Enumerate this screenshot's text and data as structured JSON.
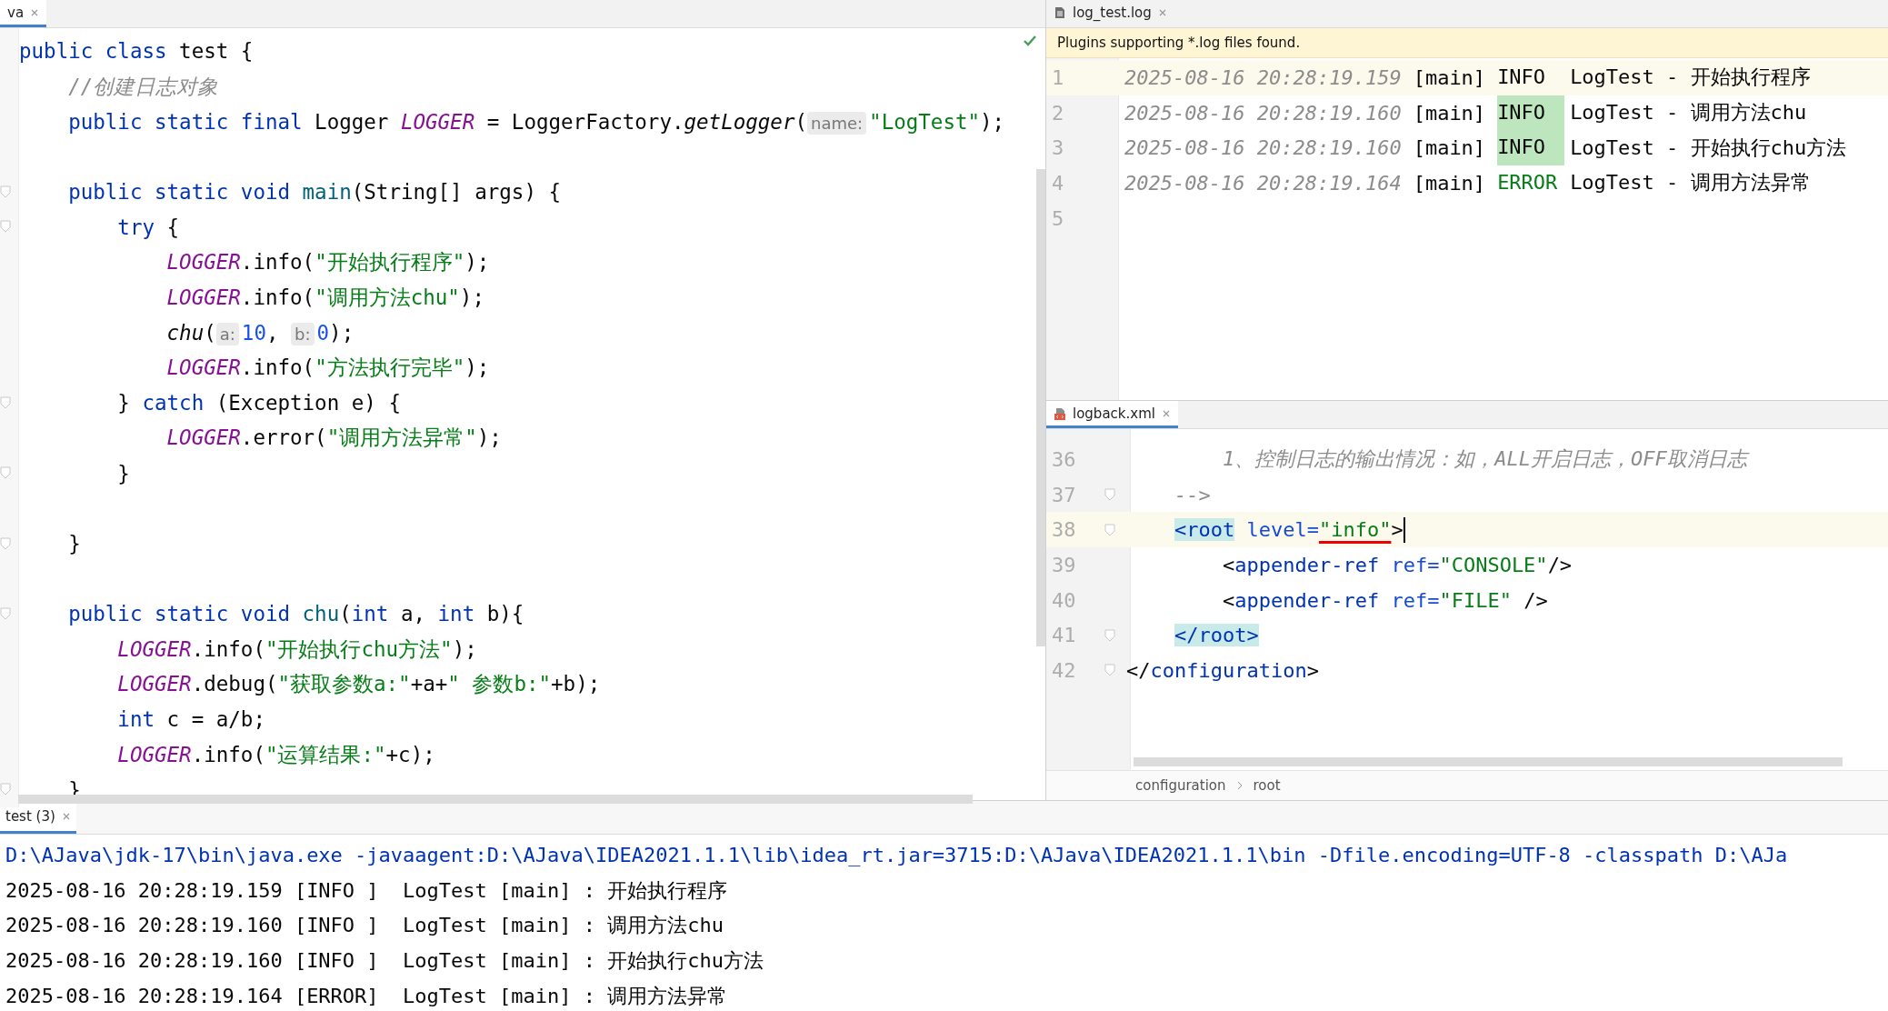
{
  "editor": {
    "tab": {
      "label": "va",
      "selected": true
    },
    "lines": [
      {
        "fold": false,
        "tokens": [
          {
            "kind": "kw",
            "text": "public class"
          },
          {
            "kind": "plain",
            "text": " test {"
          }
        ]
      },
      {
        "fold": false,
        "tokens": [
          {
            "kind": "comment",
            "text": "    //创建日志对象"
          }
        ]
      },
      {
        "fold": false,
        "tokens": [
          {
            "kind": "kw",
            "text": "    public static final"
          },
          {
            "kind": "plain",
            "text": " Logger "
          },
          {
            "kind": "const",
            "text": "LOGGER"
          },
          {
            "kind": "plain",
            "text": " = LoggerFactory."
          },
          {
            "kind": "italic",
            "text": "getLogger"
          },
          {
            "kind": "plain",
            "text": "("
          },
          {
            "kind": "hint",
            "text": "name:"
          },
          {
            "kind": "str",
            "text": "\"LogTest\""
          },
          {
            "kind": "plain",
            "text": ");"
          }
        ]
      },
      {
        "fold": false
      },
      {
        "fold": true,
        "tokens": [
          {
            "kind": "kw",
            "text": "    public static void"
          },
          {
            "kind": "method",
            "text": " main"
          },
          {
            "kind": "plain",
            "text": "(String[] args) {"
          }
        ]
      },
      {
        "fold": true,
        "tokens": [
          {
            "kind": "kw",
            "text": "        try"
          },
          {
            "kind": "plain",
            "text": " {"
          }
        ]
      },
      {
        "fold": false,
        "tokens": [
          {
            "kind": "const",
            "text": "            LOGGER"
          },
          {
            "kind": "plain",
            "text": ".info("
          },
          {
            "kind": "str",
            "text": "\"开始执行程序\""
          },
          {
            "kind": "plain",
            "text": ");"
          }
        ]
      },
      {
        "fold": false,
        "tokens": [
          {
            "kind": "const",
            "text": "            LOGGER"
          },
          {
            "kind": "plain",
            "text": ".info("
          },
          {
            "kind": "str",
            "text": "\"调用方法chu\""
          },
          {
            "kind": "plain",
            "text": ");"
          }
        ]
      },
      {
        "fold": false,
        "tokens": [
          {
            "kind": "italic",
            "text": "            chu"
          },
          {
            "kind": "plain",
            "text": "("
          },
          {
            "kind": "hint",
            "text": "a:"
          },
          {
            "kind": "num",
            "text": "10"
          },
          {
            "kind": "plain",
            "text": ", "
          },
          {
            "kind": "hint",
            "text": "b:"
          },
          {
            "kind": "num",
            "text": "0"
          },
          {
            "kind": "plain",
            "text": ");"
          }
        ]
      },
      {
        "fold": false,
        "tokens": [
          {
            "kind": "const",
            "text": "            LOGGER"
          },
          {
            "kind": "plain",
            "text": ".info("
          },
          {
            "kind": "str",
            "text": "\"方法执行完毕\""
          },
          {
            "kind": "plain",
            "text": ");"
          }
        ]
      },
      {
        "fold": true,
        "tokens": [
          {
            "kind": "plain",
            "text": "        } "
          },
          {
            "kind": "kw",
            "text": "catch"
          },
          {
            "kind": "plain",
            "text": " (Exception e) {"
          }
        ]
      },
      {
        "fold": false,
        "tokens": [
          {
            "kind": "const",
            "text": "            LOGGER"
          },
          {
            "kind": "plain",
            "text": ".error("
          },
          {
            "kind": "str",
            "text": "\"调用方法异常\""
          },
          {
            "kind": "plain",
            "text": ");"
          }
        ]
      },
      {
        "fold": true,
        "tokens": [
          {
            "kind": "plain",
            "text": "        }"
          }
        ]
      },
      {
        "fold": false
      },
      {
        "fold": true,
        "tokens": [
          {
            "kind": "plain",
            "text": "    }"
          }
        ]
      },
      {
        "fold": false
      },
      {
        "fold": true,
        "tokens": [
          {
            "kind": "kw",
            "text": "    public static void"
          },
          {
            "kind": "method",
            "text": " chu"
          },
          {
            "kind": "plain",
            "text": "("
          },
          {
            "kind": "kw",
            "text": "int"
          },
          {
            "kind": "plain",
            "text": " a, "
          },
          {
            "kind": "kw",
            "text": "int"
          },
          {
            "kind": "plain",
            "text": " b){"
          }
        ]
      },
      {
        "fold": false,
        "tokens": [
          {
            "kind": "const",
            "text": "        LOGGER"
          },
          {
            "kind": "plain",
            "text": ".info("
          },
          {
            "kind": "str",
            "text": "\"开始执行chu方法\""
          },
          {
            "kind": "plain",
            "text": ");"
          }
        ]
      },
      {
        "fold": false,
        "tokens": [
          {
            "kind": "const",
            "text": "        LOGGER"
          },
          {
            "kind": "plain",
            "text": ".debug("
          },
          {
            "kind": "str",
            "text": "\"获取参数a:\""
          },
          {
            "kind": "plain",
            "text": "+a+"
          },
          {
            "kind": "str",
            "text": "\" 参数b:\""
          },
          {
            "kind": "plain",
            "text": "+b);"
          }
        ]
      },
      {
        "fold": false,
        "tokens": [
          {
            "kind": "kw",
            "text": "        int"
          },
          {
            "kind": "plain",
            "text": " c = a/b;"
          }
        ]
      },
      {
        "fold": false,
        "tokens": [
          {
            "kind": "const",
            "text": "        LOGGER"
          },
          {
            "kind": "plain",
            "text": ".info("
          },
          {
            "kind": "str",
            "text": "\"运算结果:\""
          },
          {
            "kind": "plain",
            "text": "+c);"
          }
        ]
      },
      {
        "fold": true,
        "tokens": [
          {
            "kind": "plain",
            "text": "    }"
          }
        ]
      }
    ]
  },
  "log_viewer": {
    "tab": {
      "label": "log_test.log",
      "selected": false
    },
    "banner": "Plugins supporting *.log files found.",
    "lines": [
      {
        "number": "1",
        "current": true,
        "highlighted": false,
        "kind": "info",
        "timestamp": "2025-08-16 20:28:19.159",
        "thread": "[main]",
        "level": "INFO",
        "rest": "LogTest - 开始执行程序"
      },
      {
        "number": "2",
        "current": false,
        "highlighted": true,
        "kind": "info",
        "timestamp": "2025-08-16 20:28:19.160",
        "thread": "[main]",
        "level": "INFO",
        "rest": "LogTest - 调用方法chu"
      },
      {
        "number": "3",
        "current": false,
        "highlighted": true,
        "kind": "info",
        "timestamp": "2025-08-16 20:28:19.160",
        "thread": "[main]",
        "level": "INFO",
        "rest": "LogTest - 开始执行chu方法"
      },
      {
        "number": "4",
        "current": false,
        "highlighted": false,
        "kind": "error",
        "timestamp": "2025-08-16 20:28:19.164",
        "thread": "[main]",
        "level": "ERROR",
        "rest": "LogTest - 调用方法异常"
      },
      {
        "number": "5",
        "current": false
      }
    ]
  },
  "xml_editor": {
    "tab": {
      "label": "logback.xml",
      "selected": true
    },
    "lines": [
      {
        "number": "36",
        "current": false,
        "fold": false,
        "tokens": [
          {
            "kind": "comment",
            "text": "        1、控制日志的输出情况：如，ALL开启日志，OFF取消日志"
          }
        ]
      },
      {
        "number": "37",
        "current": false,
        "fold": true,
        "tokens": [
          {
            "kind": "comment",
            "text": "    -->"
          }
        ]
      },
      {
        "number": "38",
        "current": true,
        "fold": true,
        "tokens": [
          {
            "kind": "tagmatch",
            "text": "    <root"
          },
          {
            "kind": "attr",
            "text": " level="
          },
          {
            "kind": "strerr",
            "text": "\"info\""
          },
          {
            "kind": "plain",
            "text": ">"
          }
        ]
      },
      {
        "number": "39",
        "current": false,
        "fold": false,
        "tokens": [
          {
            "kind": "plain",
            "text": "        <"
          },
          {
            "kind": "tag",
            "text": "appender-ref"
          },
          {
            "kind": "attr",
            "text": " ref="
          },
          {
            "kind": "str",
            "text": "\"CONSOLE\""
          },
          {
            "kind": "plain",
            "text": "/>"
          }
        ]
      },
      {
        "number": "40",
        "current": false,
        "fold": false,
        "tokens": [
          {
            "kind": "plain",
            "text": "        <"
          },
          {
            "kind": "tag",
            "text": "appender-ref"
          },
          {
            "kind": "attr",
            "text": " ref="
          },
          {
            "kind": "str",
            "text": "\"FILE\""
          },
          {
            "kind": "plain",
            "text": " />"
          }
        ]
      },
      {
        "number": "41",
        "current": false,
        "fold": true,
        "tokens": [
          {
            "kind": "tagmatch",
            "text": "    </root>"
          }
        ]
      },
      {
        "number": "42",
        "current": false,
        "fold": true,
        "tokens": [
          {
            "kind": "plain",
            "text": "</"
          },
          {
            "kind": "tag",
            "text": "configuration"
          },
          {
            "kind": "plain",
            "text": ">"
          }
        ]
      }
    ],
    "breadcrumbs": [
      "configuration",
      "root"
    ]
  },
  "console": {
    "tab": {
      "label": "test (3)",
      "selected": true
    },
    "lines": [
      {
        "kind": "command",
        "text": "D:\\AJava\\jdk-17\\bin\\java.exe -javaagent:D:\\AJava\\IDEA2021.1.1\\lib\\idea_rt.jar=3715:D:\\AJava\\IDEA2021.1.1\\bin -Dfile.encoding=UTF-8 -classpath D:\\AJa"
      },
      {
        "kind": "output",
        "text": "2025-08-16 20:28:19.159 [INFO ]  LogTest [main] : 开始执行程序"
      },
      {
        "kind": "output",
        "text": "2025-08-16 20:28:19.160 [INFO ]  LogTest [main] : 调用方法chu"
      },
      {
        "kind": "output",
        "text": "2025-08-16 20:28:19.160 [INFO ]  LogTest [main] : 开始执行chu方法"
      },
      {
        "kind": "output",
        "text": "2025-08-16 20:28:19.164 [ERROR]  LogTest [main] : 调用方法异常"
      }
    ]
  }
}
